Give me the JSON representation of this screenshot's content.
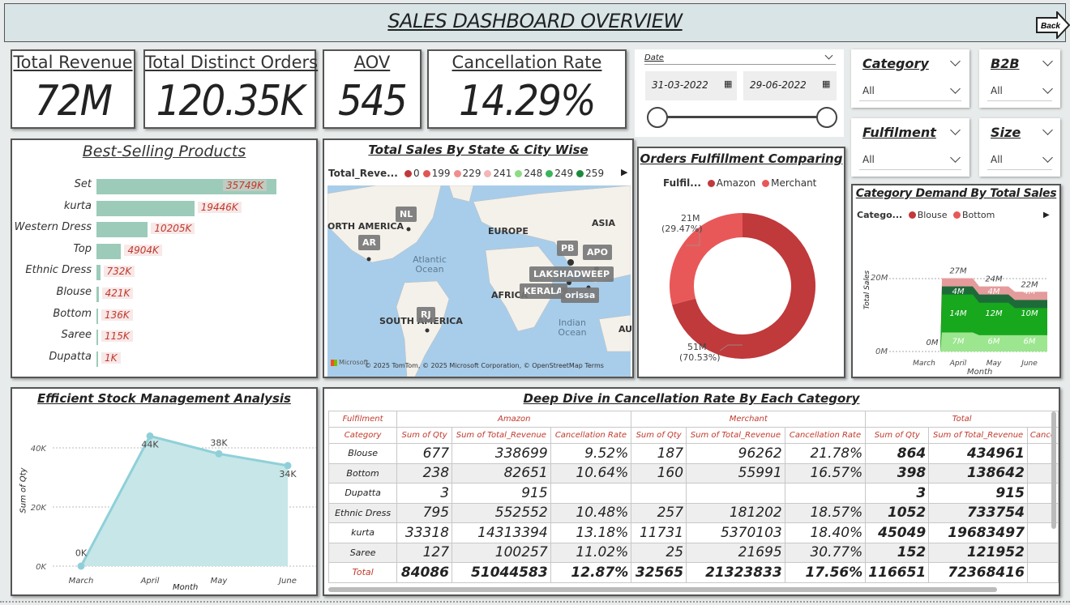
{
  "header": {
    "title": "SALES DASHBOARD OVERVIEW",
    "back_label": "Back"
  },
  "kpis": [
    {
      "label": "Total Revenue",
      "value": "72M"
    },
    {
      "label": "Total Distinct Orders",
      "value": "120.35K"
    },
    {
      "label": "AOV",
      "value": "545"
    },
    {
      "label": "Cancellation Rate",
      "value": "14.29%"
    }
  ],
  "date_slicer": {
    "label": "Date",
    "start": "31-03-2022",
    "end": "29-06-2022"
  },
  "slicers": {
    "category": {
      "label": "Category",
      "value": "All"
    },
    "b2b": {
      "label": "B2B",
      "value": "All"
    },
    "fulfilment": {
      "label": "Fulfilment",
      "value": "All"
    },
    "size": {
      "label": "Size",
      "value": "All"
    }
  },
  "best_selling": {
    "title": "Best-Selling Products"
  },
  "map": {
    "title": "Total Sales By State & City Wise",
    "legend_title": "Total_Reve...",
    "legend": [
      {
        "label": "0",
        "color": "#c0393b"
      },
      {
        "label": "199",
        "color": "#e05555"
      },
      {
        "label": "229",
        "color": "#ef8e8e"
      },
      {
        "label": "241",
        "color": "#f4b6b6"
      },
      {
        "label": "248",
        "color": "#8fdb84"
      },
      {
        "label": "249",
        "color": "#3bb55a"
      },
      {
        "label": "259",
        "color": "#1e8a3a"
      }
    ],
    "labels": {
      "na": "ORTH AMERICA",
      "asia": "ASIA",
      "europe": "EUROPE",
      "africa": "AFRICA",
      "sa": "SOUTH AMERICA",
      "au": "AU",
      "atlantic": "Atlantic Ocean",
      "indian": "Indian Ocean"
    },
    "pins": {
      "nl": "NL",
      "ar": "AR",
      "pb": "PB",
      "apo": "APO",
      "laks": "LAKSHADWEEP",
      "kerala": "KERALA",
      "orissa": "orissa",
      "rj": "RJ"
    },
    "attribution": "© 2025 TomTom, © 2025 Microsoft Corporation, © OpenStreetMap  Terms",
    "ms": "Microsoft"
  },
  "fulfillment": {
    "title": "Orders Fulfillment Comparing",
    "legend_title": "Fulfil...",
    "legend": [
      {
        "label": "Amazon",
        "color": "#c0393b"
      },
      {
        "label": "Merchant",
        "color": "#e85858"
      }
    ],
    "label_small": "21M",
    "label_small_pct": "(29.47%)",
    "label_big": "51M",
    "label_big_pct": "(70.53%)"
  },
  "category_demand": {
    "title": "Category Demand By Total Sales",
    "legend_title": "Catego...",
    "legend": [
      {
        "label": "Blouse",
        "color": "#c0393b"
      },
      {
        "label": "Bottom",
        "color": "#e85858"
      }
    ],
    "ylabel": "Total Sales",
    "xlabel": "Month",
    "y20": "20M",
    "y0": "0M",
    "months": [
      "March",
      "April",
      "May",
      "June"
    ],
    "totals": [
      "0M",
      "27M",
      "24M",
      "22M"
    ],
    "seg_top": [
      "",
      "4M",
      "4M",
      "4M"
    ],
    "seg_mid": [
      "",
      "14M",
      "12M",
      "10M"
    ],
    "seg_bot": [
      "",
      "7M",
      "6M",
      "6M"
    ]
  },
  "stock": {
    "title": "Efficient Stock Management Analysis",
    "ylabel": "Sum of Qty",
    "xlabel": "Month",
    "ticks": [
      "0K",
      "20K",
      "40K"
    ]
  },
  "table": {
    "title": "Deep Dive in Cancellation Rate By Each Category",
    "h1": [
      "Fulfilment",
      "Amazon",
      "Merchant",
      "Total"
    ],
    "h2": [
      "Category",
      "Sum of Qty",
      "Sum of Total_Revenue",
      "Cancellation Rate",
      "Sum of Qty",
      "Sum of Total_Revenue",
      "Cancellation Rate",
      "Sum of Qty",
      "Sum of Total_Revenue",
      "Cance"
    ],
    "rows": [
      [
        "Blouse",
        "677",
        "338699",
        "9.52%",
        "187",
        "96262",
        "21.78%",
        "864",
        "434961"
      ],
      [
        "Bottom",
        "238",
        "82651",
        "10.64%",
        "160",
        "55991",
        "16.57%",
        "398",
        "138642"
      ],
      [
        "Dupatta",
        "3",
        "915",
        "",
        "",
        "",
        "",
        "3",
        "915"
      ],
      [
        "Ethnic Dress",
        "795",
        "552552",
        "10.48%",
        "257",
        "181202",
        "18.57%",
        "1052",
        "733754"
      ],
      [
        "kurta",
        "33318",
        "14313394",
        "13.18%",
        "11731",
        "5370103",
        "18.40%",
        "45049",
        "19683497"
      ],
      [
        "Saree",
        "127",
        "100257",
        "11.02%",
        "25",
        "21695",
        "30.77%",
        "152",
        "121952"
      ],
      [
        "Total",
        "84086",
        "51044583",
        "12.87%",
        "32565",
        "21323833",
        "17.56%",
        "116651",
        "72368416"
      ]
    ]
  },
  "chart_data": [
    {
      "type": "bar",
      "title": "Best-Selling Products",
      "categories": [
        "Set",
        "kurta",
        "Western Dress",
        "Top",
        "Ethnic Dress",
        "Blouse",
        "Bottom",
        "Saree",
        "Dupatta"
      ],
      "values": [
        35749,
        19446,
        10205,
        4904,
        732,
        421,
        136,
        115,
        1
      ],
      "labels": [
        "35749K",
        "19446K",
        "10205K",
        "4904K",
        "732K",
        "421K",
        "136K",
        "115K",
        "1K"
      ]
    },
    {
      "type": "pie",
      "title": "Orders Fulfillment Comparing",
      "categories": [
        "Amazon",
        "Merchant"
      ],
      "values": [
        51,
        21
      ]
    },
    {
      "type": "bar",
      "title": "Category Demand By Total Sales",
      "categories": [
        "March",
        "April",
        "May",
        "June"
      ],
      "values": [
        0,
        27,
        24,
        22
      ],
      "ylabel": "Total Sales",
      "xlabel": "Month"
    },
    {
      "type": "area",
      "title": "Efficient Stock Management Analysis",
      "categories": [
        "March",
        "April",
        "May",
        "June"
      ],
      "values": [
        0,
        44,
        38,
        34
      ],
      "labels": [
        "0K",
        "44K",
        "38K",
        "34K"
      ],
      "ylabel": "Sum of Qty",
      "xlabel": "Month",
      "ylim": [
        0,
        48
      ]
    }
  ]
}
